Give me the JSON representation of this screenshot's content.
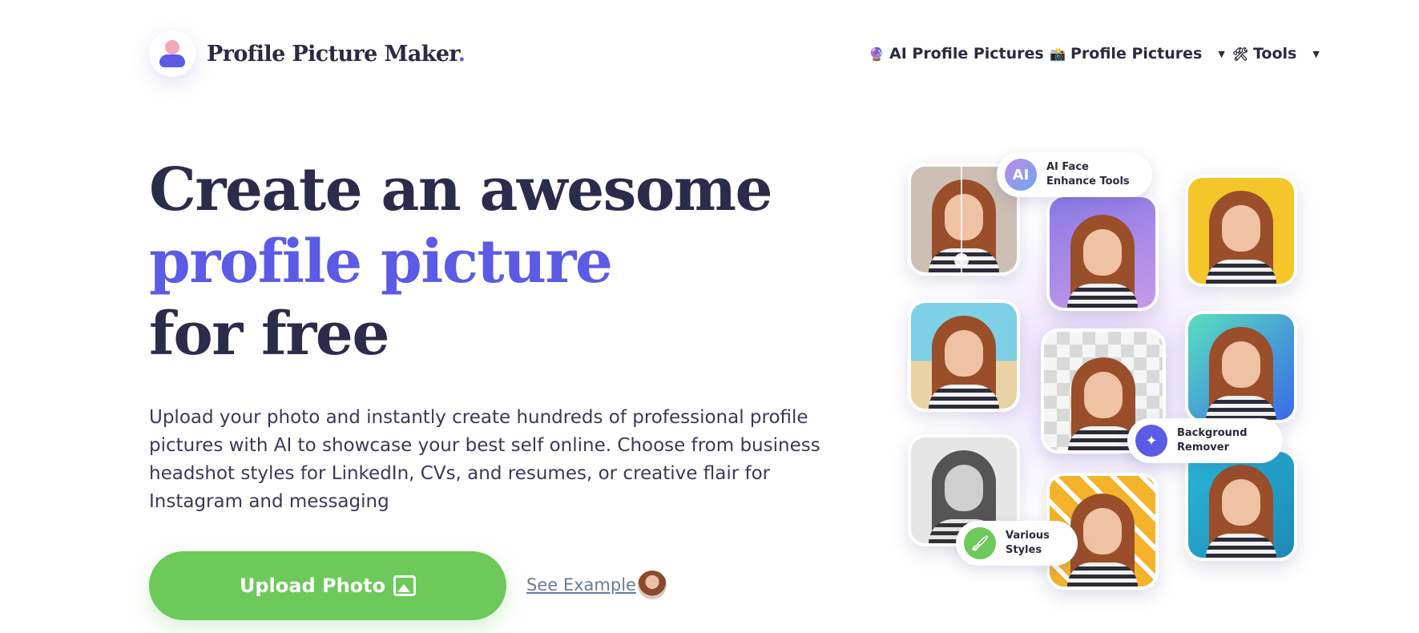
{
  "header": {
    "logo_text": "Profile Picture Maker",
    "logo_dot": ".",
    "nav": [
      {
        "label": "AI Profile Pictures",
        "icon": "🔮",
        "icon_name": "crystal-ball-icon",
        "has_dropdown": false
      },
      {
        "label": "Profile Pictures",
        "icon": "📸",
        "icon_name": "camera-icon",
        "has_dropdown": true
      },
      {
        "label": "Tools",
        "icon": "🛠",
        "icon_name": "tools-icon",
        "has_dropdown": true
      }
    ],
    "caret": "▼"
  },
  "hero": {
    "title_line1": "Create an awesome",
    "title_line2": "profile picture",
    "title_line3": "for free",
    "description": "Upload your photo and instantly create hundreds of professional profile pictures with AI to showcase your best self online. Choose from business headshot styles for LinkedIn, CVs, and resumes, or creative flair for Instagram and messaging",
    "upload_button": "Upload Photo",
    "see_example": "See Example"
  },
  "collage": {
    "badges": [
      {
        "icon_text": "AI",
        "label": "AI Face Enhance Tools",
        "icon_name": "ai-icon"
      },
      {
        "icon_text": "✦",
        "label": "Background Remover",
        "icon_name": "magic-wand-icon"
      },
      {
        "icon_text": "🖌",
        "label": "Various Styles",
        "icon_name": "brush-icon"
      }
    ]
  },
  "colors": {
    "accent": "#5b5be6",
    "title": "#2b2b4b",
    "button": "#6cc95a",
    "link": "#6b7a99"
  }
}
